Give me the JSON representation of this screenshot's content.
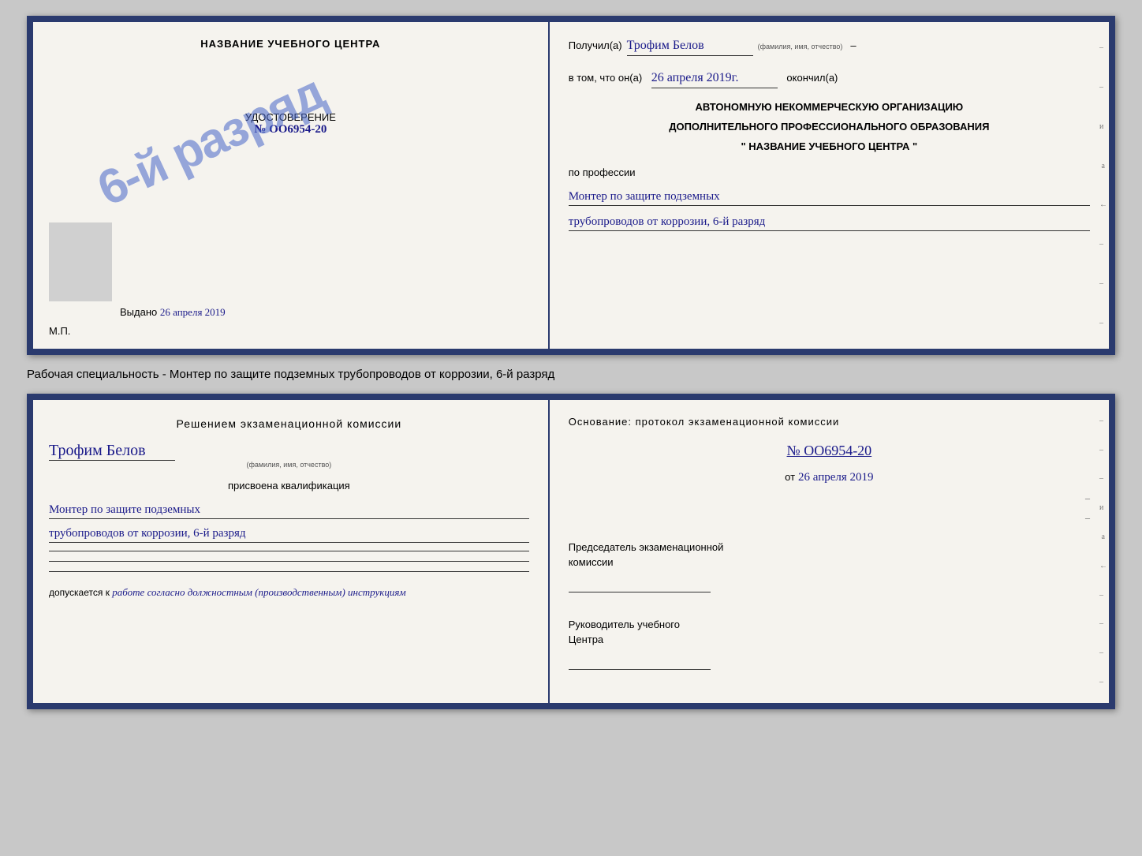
{
  "top_cert": {
    "left": {
      "title": "НАЗВАНИЕ УЧЕБНОГО ЦЕНТРА",
      "stamp_text": "6-й разряд",
      "udost_label": "УДОСТОВЕРЕНИЕ",
      "udost_number": "№ OO6954-20",
      "vydano_label": "Выдано",
      "vydano_date": "26 апреля 2019",
      "mp_label": "М.П."
    },
    "right": {
      "poluchil": "Получил(а)",
      "name_handwritten": "Трофим Белов",
      "name_sublabel": "(фамилия, имя, отчество)",
      "dash1": "–",
      "v_tom_chto": "в том, что он(а)",
      "date_handwritten": "26 апреля 2019г.",
      "okonchil": "окончил(а)",
      "org_line1": "АВТОНОМНУЮ НЕКОММЕРЧЕСКУЮ ОРГАНИЗАЦИЮ",
      "org_line2": "ДОПОЛНИТЕЛЬНОГО ПРОФЕССИОНАЛЬНОГО ОБРАЗОВАНИЯ",
      "org_line3": "\"    НАЗВАНИЕ УЧЕБНОГО ЦЕНТРА    \"",
      "po_professii": "по профессии",
      "profession_line1": "Монтер по защите подземных",
      "profession_line2": "трубопроводов от коррозии, 6-й разряд",
      "side_chars": [
        "–",
        "–",
        "и",
        "а",
        "←",
        "–",
        "–",
        "–"
      ]
    }
  },
  "specialty_label": "Рабочая специальность - Монтер по защите подземных трубопроводов от коррозии, 6-й разряд",
  "bottom_cert": {
    "left": {
      "resheniem": "Решением экзаменационной комиссии",
      "name_handwritten": "Трофим Белов",
      "name_sublabel": "(фамилия, имя, отчество)",
      "prisvoena": "присвоена квалификация",
      "qual_line1": "Монтер по защите подземных",
      "qual_line2": "трубопроводов от коррозии, 6-й разряд",
      "dopuskaetsya_label": "допускается к",
      "dopuskaetsya_value": "работе согласно должностным (производственным) инструкциям"
    },
    "right": {
      "osnovanie": "Основание: протокол экзаменационной комиссии",
      "number": "№  OO6954-20",
      "ot_label": "от",
      "ot_date": "26 апреля 2019",
      "predsedatel_line1": "Председатель экзаменационной",
      "predsedatel_line2": "комиссии",
      "rukovoditel_line1": "Руководитель учебного",
      "rukovoditel_line2": "Центра",
      "side_chars": [
        "–",
        "–",
        "–",
        "и",
        "а",
        "←",
        "–",
        "–",
        "–",
        "–"
      ]
    }
  }
}
